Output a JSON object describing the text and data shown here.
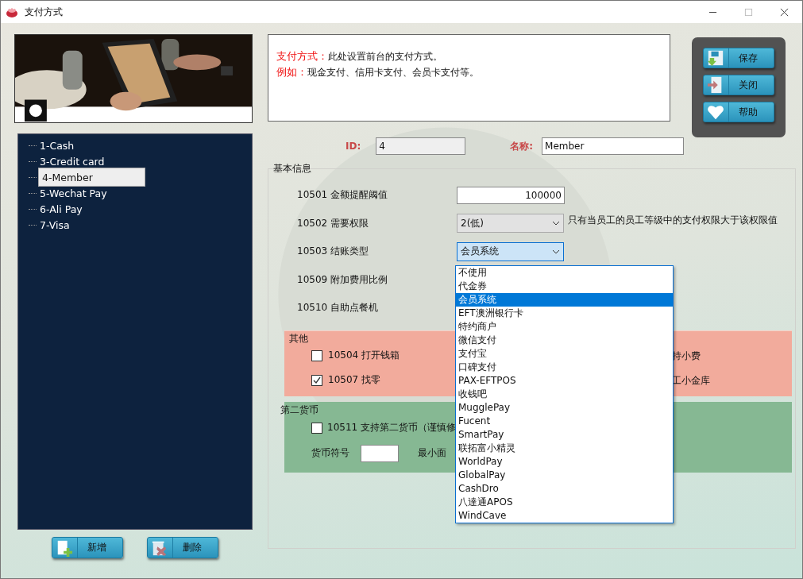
{
  "window": {
    "title": "支付方式"
  },
  "tree": [
    {
      "label": "1-Cash",
      "selected": false
    },
    {
      "label": "3-Credit card",
      "selected": false
    },
    {
      "label": "4-Member",
      "selected": true
    },
    {
      "label": "5-Wechat Pay",
      "selected": false
    },
    {
      "label": "6-Ali Pay",
      "selected": false
    },
    {
      "label": "7-Visa",
      "selected": false
    }
  ],
  "list_buttons": [
    {
      "label": "新增",
      "kind": "add"
    },
    {
      "label": "删除",
      "kind": "delete"
    }
  ],
  "info": [
    {
      "label": "支付方式：",
      "text": "此处设置前台的支付方式。"
    },
    {
      "label": "例如：",
      "text": "现金支付、信用卡支付、会员卡支付等。"
    }
  ],
  "actions": [
    {
      "label": "保存",
      "kind": "save"
    },
    {
      "label": "关闭",
      "kind": "close"
    },
    {
      "label": "帮助",
      "kind": "help"
    }
  ],
  "id_field": {
    "label": "ID:",
    "value": "4",
    "disabled": true
  },
  "name_field": {
    "label": "名称:",
    "value": "Member",
    "disabled": false
  },
  "basic": {
    "title": "基本信息",
    "rows": [
      {
        "label": "10501 金额提醒阈值",
        "kind": "input",
        "value": "100000"
      },
      {
        "label": "10502 需要权限",
        "kind": "select",
        "value": "2(低)",
        "focused": false,
        "note": "只有当员工的员工等级中的支付权限大于该权限值"
      },
      {
        "label": "10503 结账类型",
        "kind": "select",
        "value": "会员系统",
        "focused": true
      },
      {
        "label": "10509 附加费用比例",
        "kind": "hidden"
      },
      {
        "label": "10510 自助点餐机",
        "kind": "hidden"
      }
    ]
  },
  "dropdown": [
    {
      "label": "不使用",
      "selected": false
    },
    {
      "label": "代金券",
      "selected": false
    },
    {
      "label": "会员系统",
      "selected": true
    },
    {
      "label": "EFT澳洲银行卡",
      "selected": false
    },
    {
      "label": "特约商户",
      "selected": false
    },
    {
      "label": "微信支付",
      "selected": false
    },
    {
      "label": "支付宝",
      "selected": false
    },
    {
      "label": "口碑支付",
      "selected": false
    },
    {
      "label": "PAX-EFTPOS",
      "selected": false
    },
    {
      "label": "收钱吧",
      "selected": false
    },
    {
      "label": "MugglePay",
      "selected": false
    },
    {
      "label": "Fucent",
      "selected": false
    },
    {
      "label": "SmartPay",
      "selected": false
    },
    {
      "label": "联拓富小精灵",
      "selected": false
    },
    {
      "label": "WorldPay",
      "selected": false
    },
    {
      "label": "GlobalPay",
      "selected": false
    },
    {
      "label": "CashDro",
      "selected": false
    },
    {
      "label": "八達通APOS",
      "selected": false
    },
    {
      "label": "WindCave",
      "selected": false
    }
  ],
  "other": {
    "title": "其他",
    "left": [
      {
        "label": "10504 打开钱箱",
        "checked": false
      },
      {
        "label": "10507 找零",
        "checked": true
      }
    ],
    "right": [
      "持小费",
      "工小金库"
    ]
  },
  "currency": {
    "title": "第二货币",
    "checkbox": {
      "label": "10511 支持第二货币（谨慎修",
      "checked": false
    },
    "symbol_label": "货币符号",
    "min_label": "最小面"
  }
}
